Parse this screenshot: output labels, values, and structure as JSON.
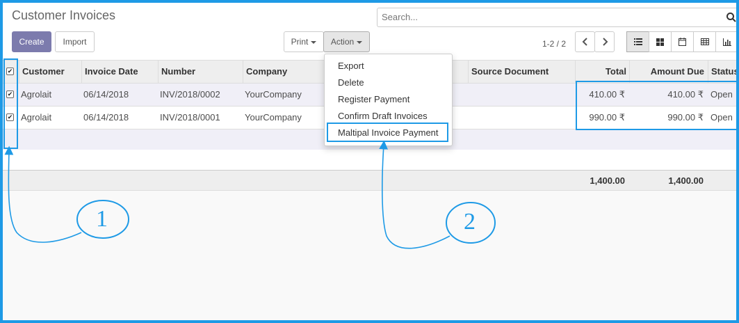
{
  "page": {
    "title": "Customer Invoices"
  },
  "search": {
    "placeholder": "Search..."
  },
  "toolbar": {
    "create_label": "Create",
    "import_label": "Import",
    "print_label": "Print",
    "action_label": "Action",
    "pager_text": "1-2 / 2"
  },
  "views": [
    "list-view-icon",
    "kanban-view-icon",
    "calendar-view-icon",
    "pivot-view-icon",
    "graph-view-icon"
  ],
  "table": {
    "columns": [
      "Customer",
      "Invoice Date",
      "Number",
      "Company",
      "Source Document",
      "Total",
      "Amount Due",
      "Status"
    ],
    "rows": [
      {
        "customer": "Agrolait",
        "invoice_date": "06/14/2018",
        "number": "INV/2018/0002",
        "company": "YourCompany",
        "total": "410.00 ₹",
        "amount_due": "410.00 ₹",
        "status": "Open"
      },
      {
        "customer": "Agrolait",
        "invoice_date": "06/14/2018",
        "number": "INV/2018/0001",
        "company": "YourCompany",
        "total": "990.00 ₹",
        "amount_due": "990.00 ₹",
        "status": "Open"
      }
    ],
    "footer": {
      "total": "1,400.00",
      "amount_due": "1,400.00"
    }
  },
  "action_menu": {
    "items": [
      "Export",
      "Delete",
      "Register Payment",
      "Confirm Draft Invoices",
      "Maltipal Invoice Payment"
    ]
  },
  "annotations": {
    "label_1": "1",
    "label_2": "2"
  },
  "colors": {
    "accent": "#1e9ae6",
    "primary_button": "#7c7bad",
    "selected_row": "#f0eff7"
  }
}
